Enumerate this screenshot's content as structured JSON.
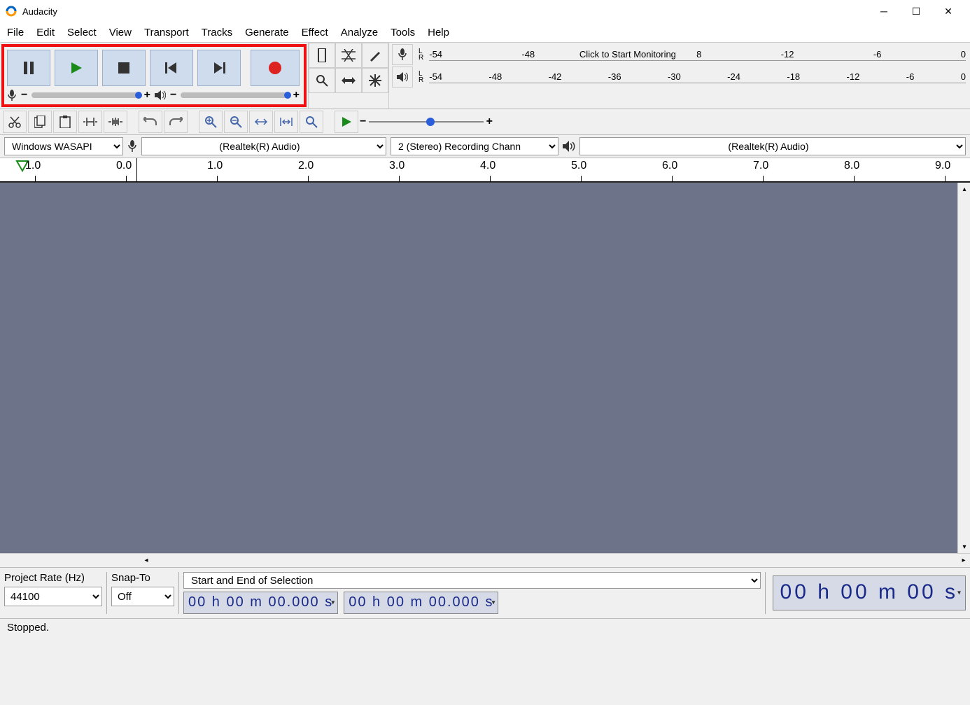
{
  "title": "Audacity",
  "menu": [
    "File",
    "Edit",
    "Select",
    "View",
    "Transport",
    "Tracks",
    "Generate",
    "Effect",
    "Analyze",
    "Tools",
    "Help"
  ],
  "meters": {
    "rec": {
      "values": [
        "-54",
        "-48",
        "-"
      ],
      "msg": "Click to Start Monitoring",
      "tail": [
        "8",
        "-12",
        "-6",
        "0"
      ]
    },
    "play": {
      "values": [
        "-54",
        "-48",
        "-42",
        "-36",
        "-30",
        "-24",
        "-18",
        "-12",
        "-6",
        "0"
      ]
    }
  },
  "devices": {
    "host": "Windows WASAPI",
    "input": "(Realtek(R) Audio)",
    "channels": "2 (Stereo) Recording Chann",
    "output": "(Realtek(R) Audio)"
  },
  "ruler": [
    "1.0",
    "0.0",
    "1.0",
    "2.0",
    "3.0",
    "4.0",
    "5.0",
    "6.0",
    "7.0",
    "8.0",
    "9.0"
  ],
  "bottom": {
    "rate_label": "Project Rate (Hz)",
    "rate_value": "44100",
    "snap_label": "Snap-To",
    "snap_value": "Off",
    "sel_label": "Start and End of Selection",
    "start": "00 h 00 m 00.000 s",
    "end": "00 h 00 m 00.000 s",
    "pos": "00 h 00 m 00 s"
  },
  "status": "Stopped."
}
